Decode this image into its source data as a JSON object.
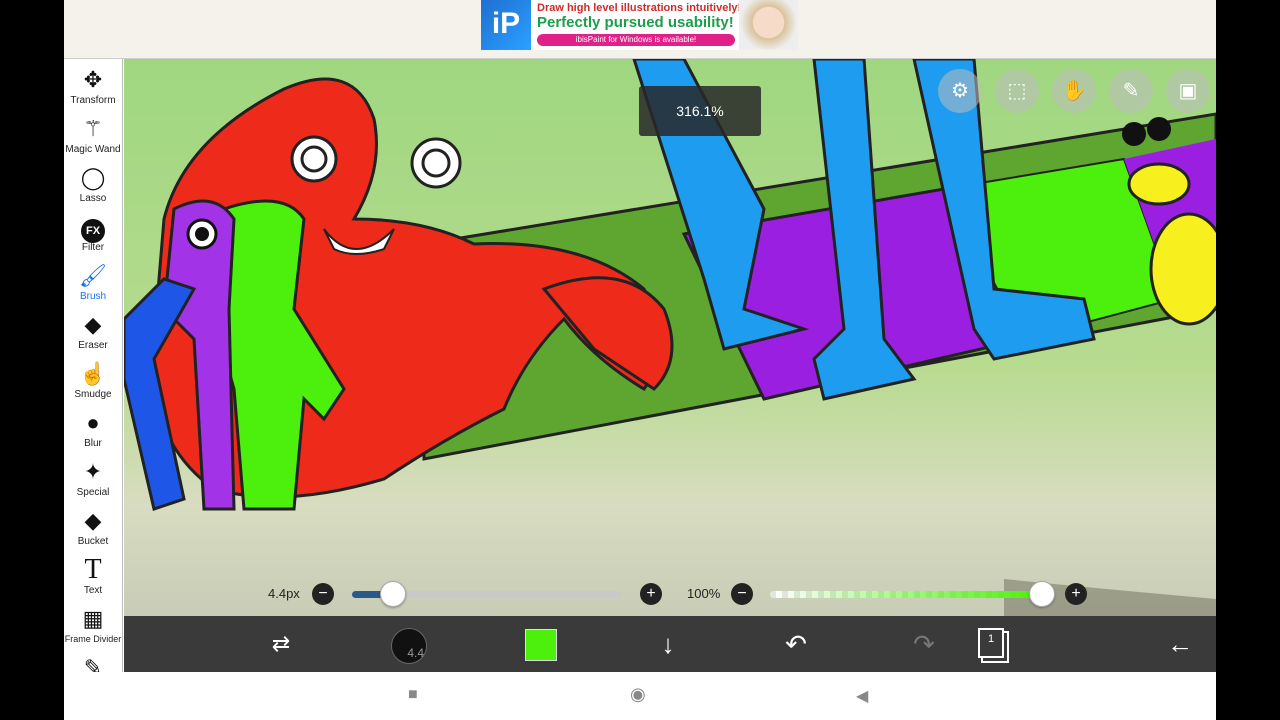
{
  "ad": {
    "logo": "iP",
    "line1": "Draw high level illustrations intuitively!",
    "line2": "Perfectly pursued usability!",
    "line3": "ibisPaint for Windows is available!"
  },
  "tools": [
    {
      "label": "Transform",
      "icon": "move-arrows-icon"
    },
    {
      "label": "Magic Wand",
      "icon": "magic-wand-icon"
    },
    {
      "label": "Lasso",
      "icon": "lasso-icon"
    },
    {
      "label": "Filter",
      "icon": "fx-icon"
    },
    {
      "label": "Brush",
      "icon": "brush-icon",
      "active": true
    },
    {
      "label": "Eraser",
      "icon": "eraser-icon"
    },
    {
      "label": "Smudge",
      "icon": "smudge-icon"
    },
    {
      "label": "Blur",
      "icon": "blur-drop-icon"
    },
    {
      "label": "Special",
      "icon": "special-pen-icon"
    },
    {
      "label": "Bucket",
      "icon": "bucket-icon"
    },
    {
      "label": "Text",
      "icon": "text-icon"
    },
    {
      "label": "Frame Divider",
      "icon": "frame-divider-icon"
    }
  ],
  "fx_text": "FX",
  "text_tool_glyph": "T",
  "canvas": {
    "zoom": "316.1%"
  },
  "sliders": {
    "brush_size": "4.4px",
    "brush_size_fraction": 0.15,
    "opacity": "100%",
    "opacity_fraction": 1.0
  },
  "bottom": {
    "brush_size_value": "4.4",
    "color": "#4cf00c",
    "layer_count": "1"
  },
  "colors": {
    "accent": "#1a73e8",
    "toolbar_dark": "#3a3a3a",
    "brush_slider_fill": "#2a5a8a",
    "opacity_slider_fill": "#4cf00c"
  }
}
